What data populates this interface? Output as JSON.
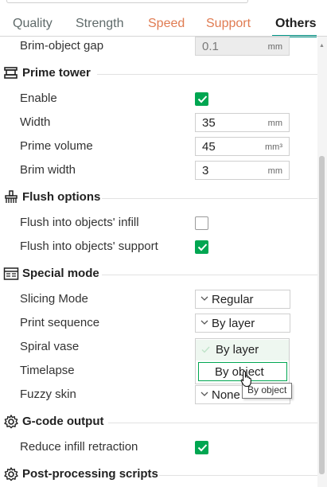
{
  "tabs": [
    {
      "label": "Quality"
    },
    {
      "label": "Strength"
    },
    {
      "label": "Speed"
    },
    {
      "label": "Support"
    },
    {
      "label": "Others"
    }
  ],
  "active_tab": "Others",
  "rows": {
    "brim_object_gap": {
      "label": "Brim-object gap",
      "value": "0.1",
      "unit": "mm"
    }
  },
  "sections": {
    "prime_tower": {
      "title": "Prime tower",
      "icon": "prime-tower-icon",
      "enable": {
        "label": "Enable",
        "checked": true
      },
      "width": {
        "label": "Width",
        "value": "35",
        "unit": "mm"
      },
      "prime_volume": {
        "label": "Prime volume",
        "value": "45",
        "unit": "mm³"
      },
      "brim_width": {
        "label": "Brim width",
        "value": "3",
        "unit": "mm"
      }
    },
    "flush_options": {
      "title": "Flush options",
      "icon": "flush-icon",
      "into_infill": {
        "label": "Flush into objects' infill",
        "checked": false
      },
      "into_support": {
        "label": "Flush into objects' support",
        "checked": true
      }
    },
    "special_mode": {
      "title": "Special mode",
      "icon": "special-mode-icon",
      "slicing_mode": {
        "label": "Slicing Mode",
        "value": "Regular"
      },
      "print_sequence": {
        "label": "Print sequence",
        "value": "By layer"
      },
      "spiral_vase": {
        "label": "Spiral vase"
      },
      "timelapse": {
        "label": "Timelapse"
      },
      "fuzzy_skin": {
        "label": "Fuzzy skin",
        "value": "None"
      }
    },
    "gcode_output": {
      "title": "G-code output",
      "icon": "gear-icon",
      "reduce_infill_retraction": {
        "label": "Reduce infill retraction",
        "checked": true
      }
    },
    "post_processing": {
      "title": "Post-processing scripts",
      "icon": "gear-icon"
    }
  },
  "print_sequence_dropdown": {
    "options": [
      "By layer",
      "By object"
    ],
    "selected": "By layer",
    "hovered": "By object"
  },
  "tooltip": "By object",
  "colors": {
    "accent": "#009688",
    "check": "#00a651",
    "orange_tab": "#e07b51"
  }
}
